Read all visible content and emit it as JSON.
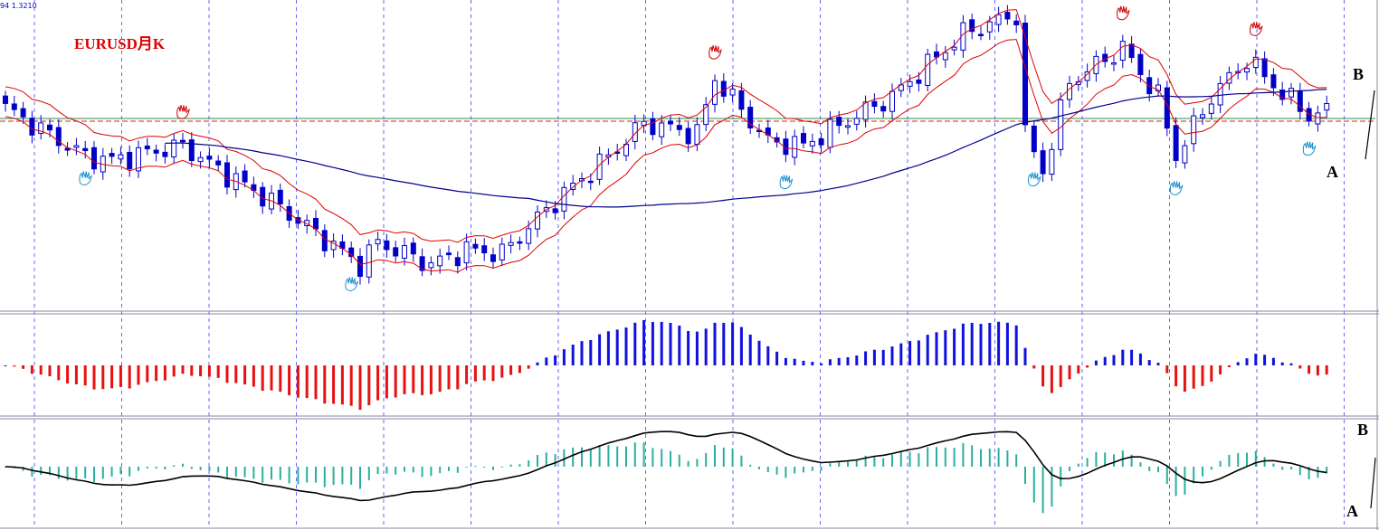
{
  "chart_data": {
    "type": "candlestick",
    "symbol_text": "EURUSD月K",
    "price_readout": "94 1.3210",
    "x_count": 150,
    "colors": {
      "up_candle": "#0000c8",
      "down_candle": "#0000c8",
      "ma_envelope": "#e00000",
      "long_ma": "#000090",
      "histogram_positive": "#1010e0",
      "histogram_negative": "#e81010",
      "osc_histogram": "#28b0a0",
      "osc_line": "#000000",
      "hline_green": "#2e8b57",
      "hline_red": "#c03000",
      "grid": "#0000ff"
    },
    "grid": {
      "vertical_dashed": true,
      "panel_dividers": true
    },
    "annotations": {
      "main_B": "B",
      "main_A": "A",
      "osc_B": "B",
      "osc_A": "A"
    },
    "close_anchors": [
      [
        0,
        1.35
      ],
      [
        9,
        1.22
      ],
      [
        12,
        1.21
      ],
      [
        20,
        1.25
      ],
      [
        23,
        1.2
      ],
      [
        30,
        1.1
      ],
      [
        40,
        0.93
      ],
      [
        42,
        0.99
      ],
      [
        48,
        0.93
      ],
      [
        52,
        0.97
      ],
      [
        56,
        0.96
      ],
      [
        62,
        1.1
      ],
      [
        68,
        1.22
      ],
      [
        72,
        1.31
      ],
      [
        78,
        1.28
      ],
      [
        80,
        1.43
      ],
      [
        86,
        1.26
      ],
      [
        90,
        1.25
      ],
      [
        96,
        1.33
      ],
      [
        100,
        1.38
      ],
      [
        108,
        1.55
      ],
      [
        114,
        1.6
      ],
      [
        115,
        1.28
      ],
      [
        117,
        1.18
      ],
      [
        120,
        1.42
      ],
      [
        126,
        1.51
      ],
      [
        130,
        1.38
      ],
      [
        132,
        1.22
      ],
      [
        136,
        1.38
      ],
      [
        140,
        1.48
      ],
      [
        144,
        1.39
      ],
      [
        147,
        1.33
      ],
      [
        149,
        1.34
      ]
    ],
    "red_hand_markers": [
      20,
      80,
      113,
      126,
      141
    ],
    "blue_hand_markers": [
      9,
      39,
      88,
      116,
      132,
      147
    ],
    "ylim_main": [
      0.82,
      1.62
    ],
    "osc1_ylim": [
      -1.1,
      1.1
    ],
    "osc2_ylim": [
      -1.2,
      1.1
    ]
  }
}
